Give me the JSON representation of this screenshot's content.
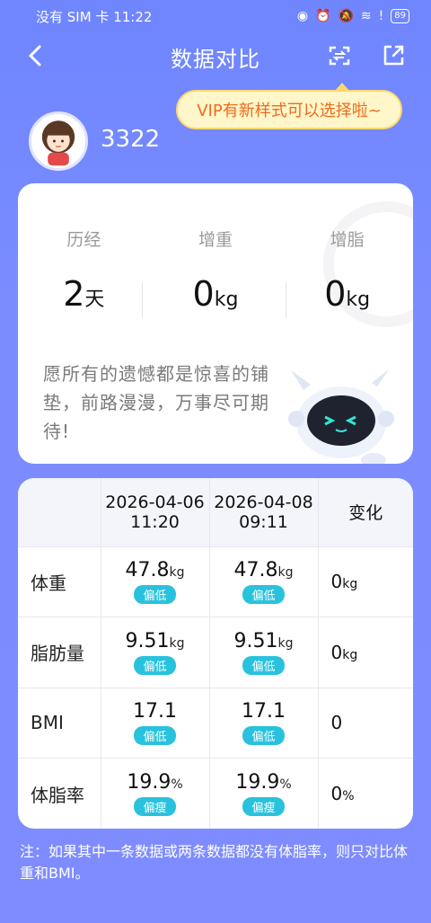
{
  "status_bar": {
    "left_text": "没有 SIM 卡 11:22",
    "battery": "89"
  },
  "header": {
    "title": "数据对比"
  },
  "vip_bubble": "VIP有新样式可以选择啦~",
  "user": {
    "name": "3322"
  },
  "summary": {
    "stats": [
      {
        "label": "历经",
        "value": "2",
        "unit": "天"
      },
      {
        "label": "增重",
        "value": "0",
        "unit": "kg"
      },
      {
        "label": "增脂",
        "value": "0",
        "unit": "kg"
      }
    ],
    "quote": "愿所有的遗憾都是惊喜的铺垫，前路漫漫，万事尽可期待!"
  },
  "table": {
    "headers": [
      {
        "date": "2026-04-06",
        "time": "11:20"
      },
      {
        "date": "2026-04-08",
        "time": "09:11"
      },
      {
        "label": "变化"
      }
    ],
    "rows": [
      {
        "name": "体重",
        "v1": "47.8",
        "u1": "kg",
        "b1": "偏低",
        "v2": "47.8",
        "u2": "kg",
        "b2": "偏低",
        "change": "0",
        "cu": "kg"
      },
      {
        "name": "脂肪量",
        "v1": "9.51",
        "u1": "kg",
        "b1": "偏低",
        "v2": "9.51",
        "u2": "kg",
        "b2": "偏低",
        "change": "0",
        "cu": "kg"
      },
      {
        "name": "BMI",
        "v1": "17.1",
        "u1": "",
        "b1": "偏低",
        "v2": "17.1",
        "u2": "",
        "b2": "偏低",
        "change": "0",
        "cu": ""
      },
      {
        "name": "体脂率",
        "v1": "19.9",
        "u1": "%",
        "b1": "偏瘦",
        "v2": "19.9",
        "u2": "%",
        "b2": "偏瘦",
        "change": "0",
        "cu": "%"
      }
    ]
  },
  "note": "注：如果其中一条数据或两条数据都没有体脂率，则只对比体重和BMI。",
  "colors": {
    "background": "#7b8cff",
    "badge": "#29c2dd",
    "vip_text": "#f06b1e"
  }
}
